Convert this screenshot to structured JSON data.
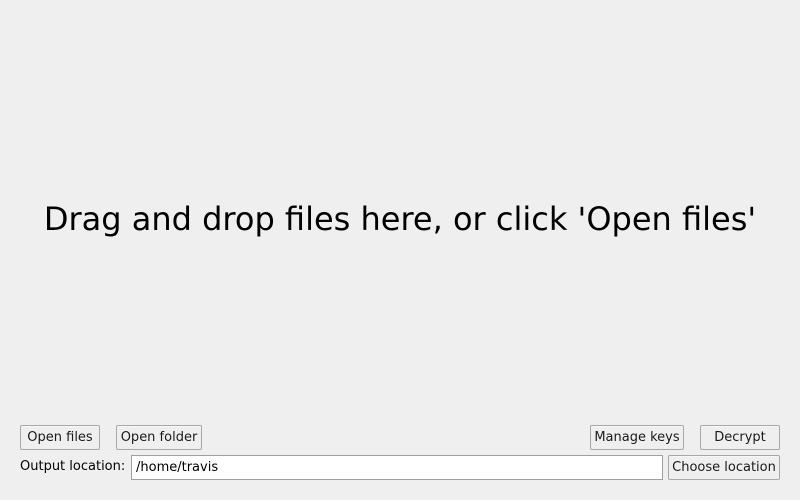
{
  "drop_zone": {
    "message": "Drag and drop files here, or click 'Open files'"
  },
  "toolbar": {
    "open_files_label": "Open files",
    "open_folder_label": "Open folder",
    "manage_keys_label": "Manage keys",
    "decrypt_label": "Decrypt"
  },
  "output": {
    "label": "Output location:",
    "value": "/home/travis",
    "choose_label": "Choose location"
  }
}
